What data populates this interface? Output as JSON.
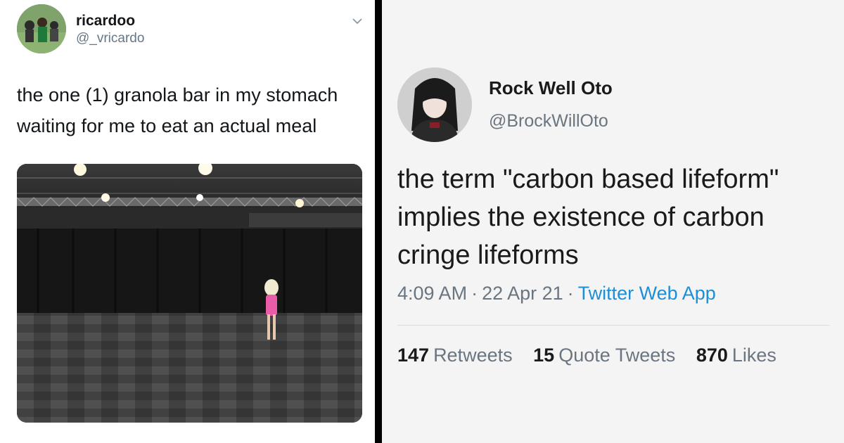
{
  "left_tweet": {
    "display_name": "ricardoo",
    "handle": "@_vricardo",
    "text": "the one (1) granola bar in my stomach waiting for me to eat an actual meal",
    "menu_icon": "chevron-down-icon",
    "media_description_icon": "embedded-photo"
  },
  "right_tweet": {
    "display_name": "Rock Well Oto",
    "handle": "@BrockWillOto",
    "text": "the term \"carbon based lifeform\" implies the existence of carbon cringe lifeforms",
    "time": "4:09 AM",
    "date": "22 Apr 21",
    "source": "Twitter Web App",
    "separator": "·",
    "stats": [
      {
        "count": "147",
        "label": "Retweets"
      },
      {
        "count": "15",
        "label": "Quote Tweets"
      },
      {
        "count": "870",
        "label": "Likes"
      }
    ]
  },
  "colors": {
    "text_primary": "#14171a",
    "text_secondary": "#657786",
    "link_blue": "#1d8fd6",
    "divider": "#000000"
  }
}
